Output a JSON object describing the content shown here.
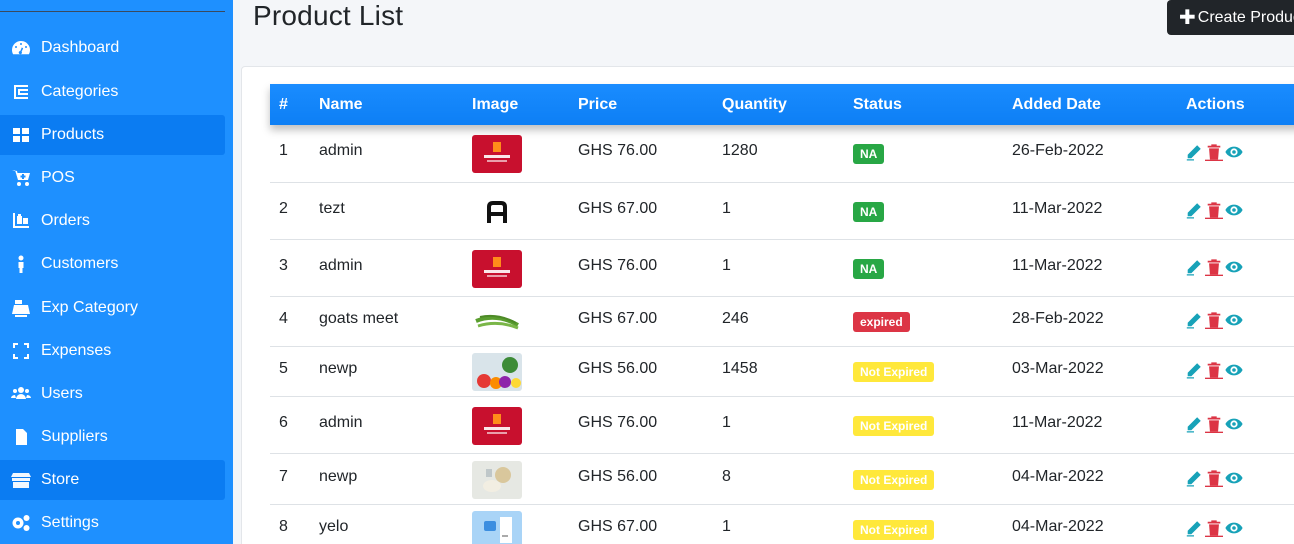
{
  "sidebar": {
    "items": [
      {
        "label": "Dashboard",
        "icon": "dashboard-icon"
      },
      {
        "label": "Categories",
        "icon": "categories-icon"
      },
      {
        "label": "Products",
        "icon": "products-icon",
        "active": true
      },
      {
        "label": "POS",
        "icon": "cart-plus-icon"
      },
      {
        "label": "Orders",
        "icon": "orders-icon"
      },
      {
        "label": "Customers",
        "icon": "customer-icon"
      },
      {
        "label": "Exp Category",
        "icon": "cash-register-icon"
      },
      {
        "label": "Expenses",
        "icon": "expand-icon"
      },
      {
        "label": "Users",
        "icon": "users-icon"
      },
      {
        "label": "Suppliers",
        "icon": "sim-card-icon"
      },
      {
        "label": "Store",
        "icon": "store-icon",
        "active": true
      },
      {
        "label": "Settings",
        "icon": "cogs-icon"
      }
    ]
  },
  "header": {
    "title": "Product List",
    "create_button": "Create Product"
  },
  "table": {
    "columns": [
      "#",
      "Name",
      "Image",
      "Price",
      "Quantity",
      "Status",
      "Added Date",
      "Actions"
    ],
    "rows": [
      {
        "num": "1",
        "name": "admin",
        "image": "red-logo-thumb",
        "price": "GHS 76.00",
        "quantity": "1280",
        "status": "NA",
        "status_color": "#28a745",
        "date": "26-Feb-2022"
      },
      {
        "num": "2",
        "name": "tezt",
        "image": "letter-a-thumb",
        "price": "GHS 67.00",
        "quantity": "1",
        "status": "NA",
        "status_color": "#28a745",
        "date": "11-Mar-2022"
      },
      {
        "num": "3",
        "name": "admin",
        "image": "red-logo-thumb",
        "price": "GHS 76.00",
        "quantity": "1",
        "status": "NA",
        "status_color": "#28a745",
        "date": "11-Mar-2022"
      },
      {
        "num": "4",
        "name": "goats meet",
        "image": "green-beans-thumb",
        "price": "GHS 67.00",
        "quantity": "246",
        "status": "expired",
        "status_color": "#dc3545",
        "date": "28-Feb-2022"
      },
      {
        "num": "5",
        "name": "newp",
        "image": "vegetables-thumb",
        "price": "GHS 56.00",
        "quantity": "1458",
        "status": "Not Expired",
        "status_color": "#ffe83b",
        "date": "03-Mar-2022"
      },
      {
        "num": "6",
        "name": "admin",
        "image": "red-logo-thumb",
        "price": "GHS 76.00",
        "quantity": "1",
        "status": "Not Expired",
        "status_color": "#ffe83b",
        "date": "11-Mar-2022"
      },
      {
        "num": "7",
        "name": "newp",
        "image": "grains-thumb",
        "price": "GHS 56.00",
        "quantity": "8",
        "status": "Not Expired",
        "status_color": "#ffe83b",
        "date": "04-Mar-2022"
      },
      {
        "num": "8",
        "name": "yelo",
        "image": "blue-doc-thumb",
        "price": "GHS 67.00",
        "quantity": "1",
        "status": "Not Expired",
        "status_color": "#ffe83b",
        "date": "04-Mar-2022"
      }
    ]
  },
  "colors": {
    "sidebar_bg": "#1e90ff",
    "edit": "#17a2b8",
    "delete": "#dc3545",
    "view": "#17a2b8"
  }
}
